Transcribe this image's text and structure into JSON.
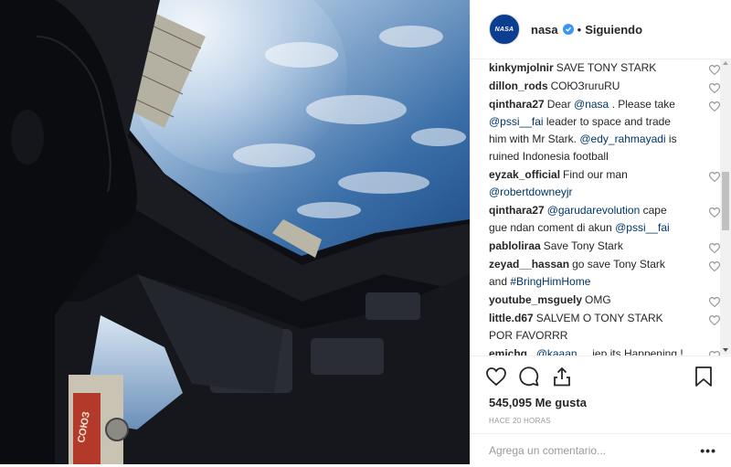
{
  "header": {
    "avatar_text": "NASA",
    "username": "nasa",
    "separator": "•",
    "follow_label": "Siguiendo"
  },
  "comments": [
    {
      "user": "kinkymjolnir",
      "parts": [
        {
          "t": "SAVE TONY STARK"
        }
      ]
    },
    {
      "user": "dillon_rods",
      "parts": [
        {
          "t": "СОЮЗruruRU"
        }
      ]
    },
    {
      "user": "qinthara27",
      "parts": [
        {
          "t": "Dear "
        },
        {
          "t": "@nasa",
          "m": true
        },
        {
          "t": " . Please take "
        },
        {
          "t": "@pssi__fai",
          "m": true
        },
        {
          "t": " leader to space and trade him with Mr Stark. "
        },
        {
          "t": "@edy_rahmayadi",
          "m": true
        },
        {
          "t": " is ruined Indonesia football"
        }
      ]
    },
    {
      "user": "eyzak_official",
      "parts": [
        {
          "t": "Find our man "
        },
        {
          "t": "@robertdowneyjr",
          "m": true
        }
      ]
    },
    {
      "user": "qinthara27",
      "parts": [
        {
          "t": "@garudarevolution",
          "m": true
        },
        {
          "t": " cape gue ndan coment di akun "
        },
        {
          "t": "@pssi__fai",
          "m": true
        }
      ]
    },
    {
      "user": "pabloliraa",
      "parts": [
        {
          "t": "Save Tony Stark"
        }
      ]
    },
    {
      "user": "zeyad__hassan",
      "parts": [
        {
          "t": "go save Tony Stark and "
        },
        {
          "t": "#BringHimHome",
          "m": true
        }
      ]
    },
    {
      "user": "youtube_msguely",
      "parts": [
        {
          "t": "OMG"
        }
      ]
    },
    {
      "user": "little.d67",
      "parts": [
        {
          "t": "SALVEM O TONY STARK POR FAVORRR"
        }
      ]
    },
    {
      "user": "emichg_",
      "parts": [
        {
          "t": "@kaaan__",
          "m": true
        },
        {
          "t": " jep its Happening ! unbelievable"
        }
      ]
    }
  ],
  "likes_text": "545,095 Me gusta",
  "time_text": "HACE 20 HORAS",
  "add_comment_placeholder": "Agrega un comentario...",
  "more_options": "•••",
  "colors": {
    "mention": "#003569",
    "verified": "#3897f0",
    "text": "#262626",
    "muted": "#999999"
  },
  "photo": {
    "hull_label": "СОЮЗ"
  }
}
